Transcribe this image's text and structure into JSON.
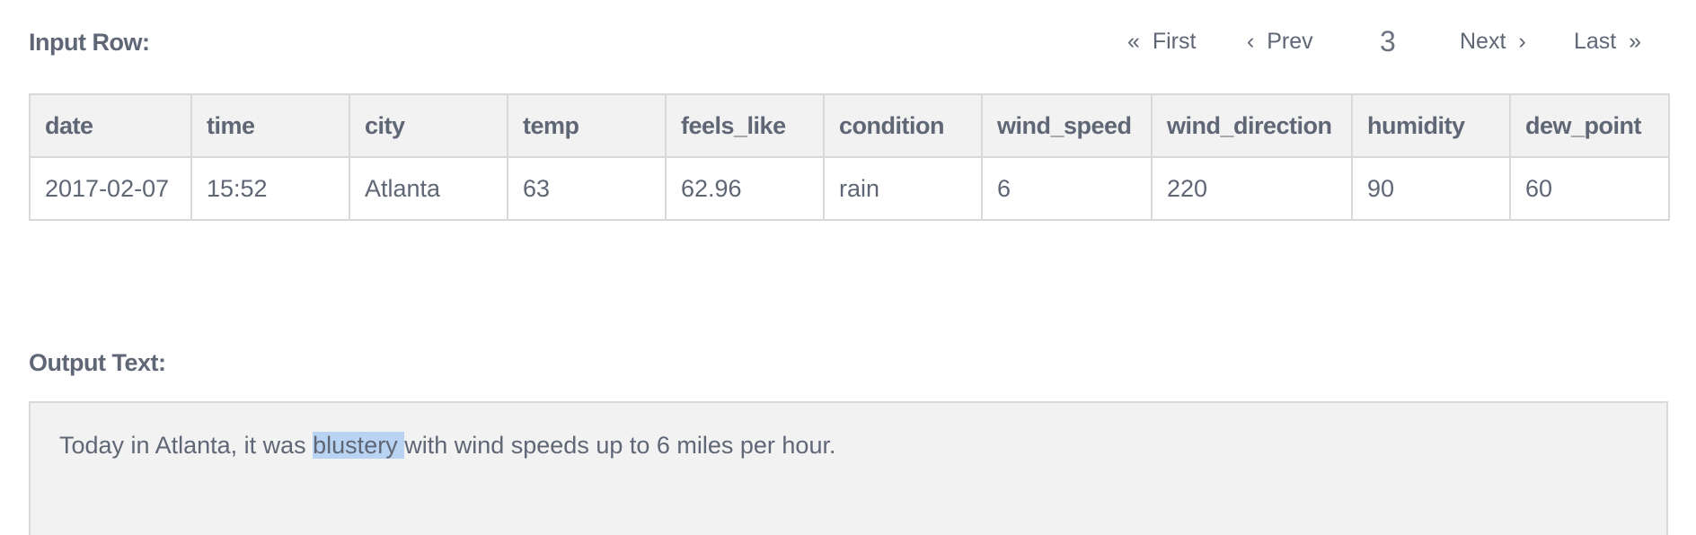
{
  "input_label": "Input Row:",
  "output_label": "Output Text:",
  "pagination": {
    "first_label": "First",
    "prev_label": "Prev",
    "current_page": "3",
    "next_label": "Next",
    "last_label": "Last",
    "first_icon": "double-chevron-left-icon",
    "prev_icon": "chevron-left-icon",
    "next_icon": "chevron-right-icon",
    "last_icon": "double-chevron-right-icon"
  },
  "table": {
    "headers": [
      "date",
      "time",
      "city",
      "temp",
      "feels_like",
      "condition",
      "wind_speed",
      "wind_direction",
      "humidity",
      "dew_point"
    ],
    "row": [
      "2017-02-07",
      "15:52",
      "Atlanta",
      "63",
      "62.96",
      "rain",
      "6",
      "220",
      "90",
      "60"
    ]
  },
  "output": {
    "before": "Today in Atlanta, it was ",
    "highlighted": "blustery ",
    "after": "with wind speeds up to 6 miles per hour."
  },
  "colors": {
    "text": "#5f6675",
    "header_bg": "#f2f2f2",
    "border": "#d9d9d9",
    "selection": "#b9d3f2"
  }
}
